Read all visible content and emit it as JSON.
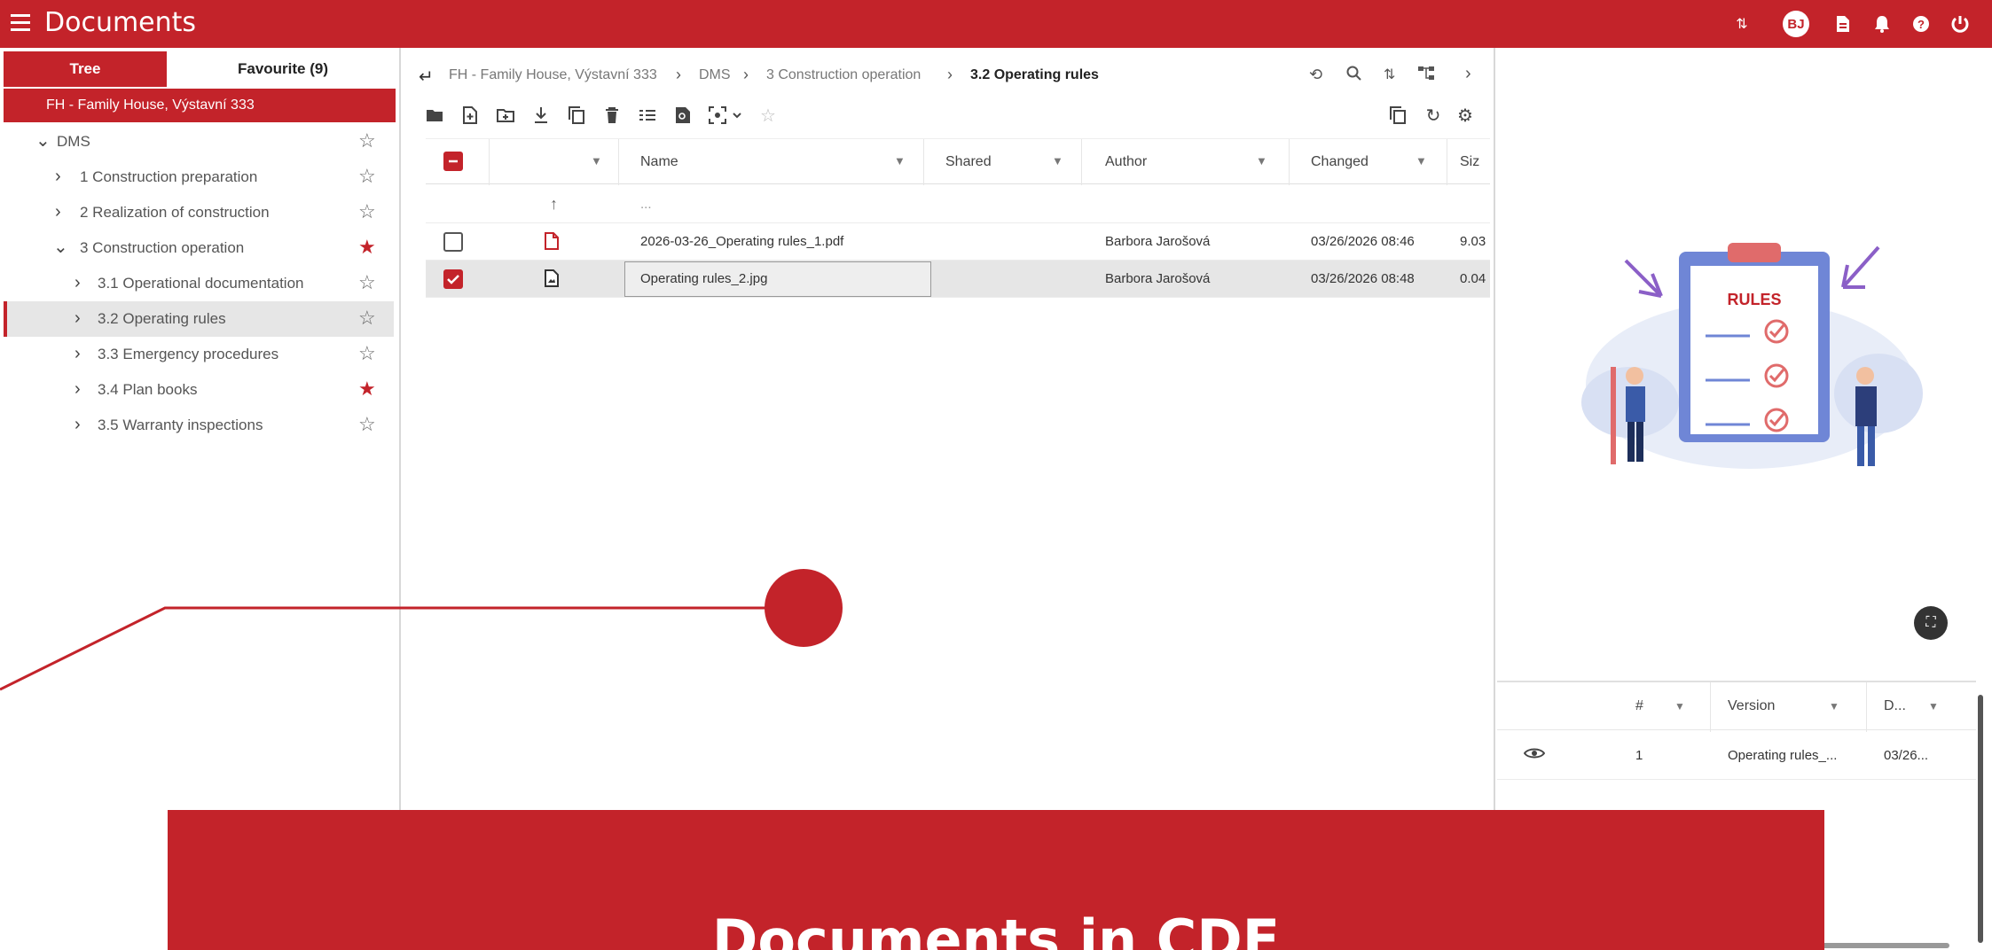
{
  "app": {
    "title": "Documents",
    "accent_color": "#c3232a",
    "avatar_initials": "BJ",
    "top_icons": [
      "sort-icon",
      "avatar",
      "document-icon",
      "bell-icon",
      "help-icon",
      "logout-icon"
    ]
  },
  "left": {
    "tabs": [
      "Tree",
      "Favourite (9)"
    ],
    "root": "FH - Family House, Výstavní 333",
    "tree": [
      {
        "label": "DMS",
        "starred": false,
        "expanded": true
      },
      {
        "label": "1 Construction preparation",
        "starred": false
      },
      {
        "label": "2 Realization of construction",
        "starred": false
      },
      {
        "label": "3 Construction operation",
        "starred": true,
        "expanded": true
      },
      {
        "label": "3.1 Operational documentation",
        "starred": false
      },
      {
        "label": "3.2 Operating rules",
        "starred": false,
        "selected": true
      },
      {
        "label": "3.3 Emergency procedures",
        "starred": false
      },
      {
        "label": "3.4 Plan books",
        "starred": true
      },
      {
        "label": "3.5 Warranty inspections",
        "starred": false
      }
    ]
  },
  "center": {
    "breadcrumb": [
      "FH - Family House, Výstavní 333",
      "DMS",
      "3 Construction operation",
      "3.2 Operating rules"
    ],
    "columns": [
      "Name",
      "Shared",
      "Author",
      "Changed",
      "Siz"
    ],
    "parent_row": "...",
    "files": [
      {
        "name": "2026-03-26_Operating rules_1.pdf",
        "author": "Barbora Jarošová",
        "changed": "03/26/2026 08:46",
        "size": "9.03",
        "type": "pdf",
        "checked": false
      },
      {
        "name": "Operating rules_2.jpg",
        "author": "Barbora Jarošová",
        "changed": "03/26/2026 08:48",
        "size": "0.04",
        "type": "image",
        "checked": true
      }
    ]
  },
  "preview": {
    "image_label": "RULES",
    "version_columns": [
      "#",
      "Version",
      "D..."
    ],
    "versions": [
      {
        "num": "1",
        "name": "Operating rules_...",
        "date": "03/26..."
      }
    ]
  },
  "banner": {
    "text": "Documents in CDE"
  }
}
